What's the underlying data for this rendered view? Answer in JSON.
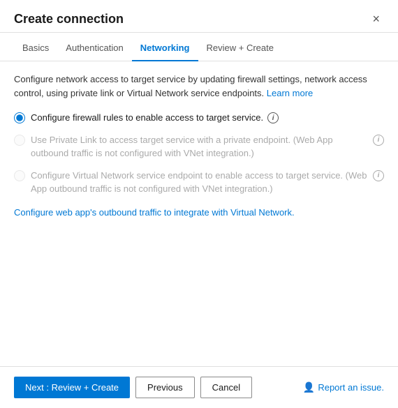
{
  "dialog": {
    "title": "Create connection",
    "close_label": "×"
  },
  "tabs": [
    {
      "id": "basics",
      "label": "Basics",
      "active": false
    },
    {
      "id": "authentication",
      "label": "Authentication",
      "active": false
    },
    {
      "id": "networking",
      "label": "Networking",
      "active": true
    },
    {
      "id": "review-create",
      "label": "Review + Create",
      "active": false
    }
  ],
  "content": {
    "description": "Configure network access to target service by updating firewall settings, network access control, using private link or Virtual Network service endpoints.",
    "learn_more_label": "Learn more",
    "radio_options": [
      {
        "id": "option1",
        "label": "Configure firewall rules to enable access to target service.",
        "checked": true,
        "disabled": false,
        "has_info": true
      },
      {
        "id": "option2",
        "label": "Use Private Link to access target service with a private endpoint. (Web App outbound traffic is not configured with VNet integration.)",
        "checked": false,
        "disabled": true,
        "has_info": true
      },
      {
        "id": "option3",
        "label": "Configure Virtual Network service endpoint to enable access to target service. (Web App outbound traffic is not configured with VNet integration.)",
        "checked": false,
        "disabled": true,
        "has_info": true
      }
    ],
    "vnet_link_label": "Configure web app's outbound traffic to integrate with Virtual Network.",
    "info_icon_label": "i"
  },
  "footer": {
    "next_label": "Next : Review + Create",
    "previous_label": "Previous",
    "cancel_label": "Cancel",
    "report_label": "Report an issue."
  }
}
